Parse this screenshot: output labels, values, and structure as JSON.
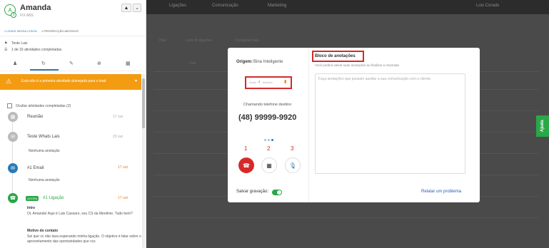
{
  "background": {
    "nav": [
      "Ligações",
      "Comunicação",
      "Marketing"
    ],
    "user": "Luis Corado",
    "left_labels": [
      "Pipe",
      "Lista de ligações",
      "Last"
    ],
    "search": "Pesquisar lista",
    "help_tab": "Ajuda"
  },
  "sidebar": {
    "avatar_letter": "A",
    "avatar_badge": "5",
    "name": "Amanda",
    "subname": "FIX ABS",
    "tags": [
      "1 LEADS NESSA CONTA",
      "1 PROSPECÇÃO ABTODOS"
    ],
    "meta": [
      "Teste Lais",
      "1 de 16 atividades completadas"
    ],
    "alert_text": "Esta não é a primeira atividade planejada para o lead",
    "hide_completed": "Ocultar atividades completadas (2)",
    "activities": [
      {
        "title": "Reunião",
        "time": "17 out",
        "note": ""
      },
      {
        "title": "Teste Whats Lais",
        "time": "23 out",
        "note": "Nenhuma anotação"
      },
      {
        "title": "#1 Email",
        "time": "17 out",
        "note": "Nenhuma anotação"
      },
      {
        "title": "#1 Ligação",
        "time": "17 out",
        "badge": "AGORA"
      }
    ],
    "intro_label": "Intro",
    "intro_text": "Oi, Amanda! Aqui é Lais Cassaro, sou CS da Meetime. Tudo bem?",
    "motivo_label": "Motivo do contato",
    "motivo_text": "Sei que vc não tava esperando minha ligação. O objetivo é falar sobre o aproveitamento das oportunidades que vcs"
  },
  "modal": {
    "origin_label": "Origem:",
    "origin_value": "Bina Inteligente",
    "audio": "Áudio",
    "internet": "Internet",
    "calling_label": "Chamando telefone destino",
    "phone": "(48) 99999-9920",
    "numbers": [
      "1",
      "2",
      "3"
    ],
    "save_recording": "Salvar gravação:",
    "report": "Relatar um problema",
    "notes_title": "Bloco de anotações",
    "notes_subtitle": "Você poderá salvar suas anotações ao finalizar a chamada",
    "notes_placeholder": "Faça anotações que possam auxiliar a sua comunicação com o cliente."
  },
  "colors": {
    "accent": "#2a7ab8",
    "green": "#2aa746",
    "red": "#d62a2a",
    "orange": "#f39c12"
  }
}
